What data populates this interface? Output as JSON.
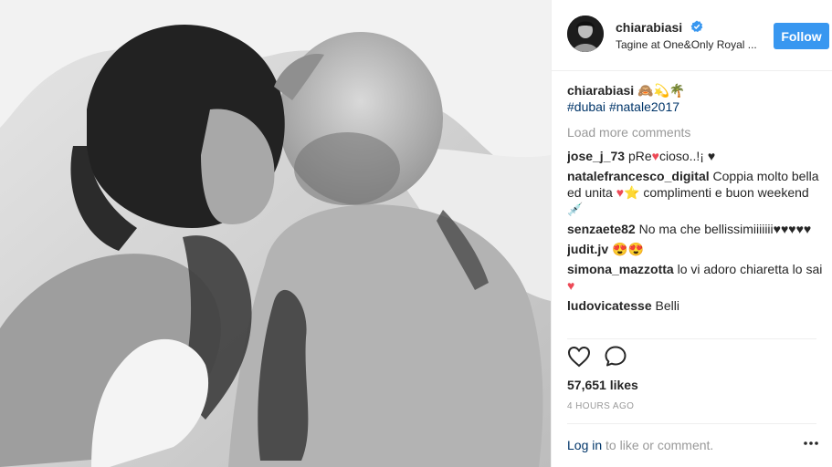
{
  "post": {
    "username": "chiarabiasi",
    "location": "Tagine at One&Only Royal ...",
    "follow_label": "Follow"
  },
  "caption": {
    "username": "chiarabiasi",
    "text": "🙈💫🌴",
    "hashtag_1": "#dubai",
    "hashtag_2": "#natale2017"
  },
  "load_more_label": "Load more comments",
  "comments": [
    {
      "user": "jose_j_73",
      "text_a": "pRe",
      "heart": "♥",
      "text_b": "cioso..!¡ ♥"
    },
    {
      "user": "natalefrancesco_digital",
      "text_a": "Coppia molto bella ed unita ",
      "heart": "♥",
      "text_b": "⭐ complimenti e buon weekend 💉"
    },
    {
      "user": "senzaete82",
      "text_a": "No ma che bellissimiiiiiii♥♥♥♥♥"
    },
    {
      "user": "judit.jv",
      "text_a": "😍😍"
    },
    {
      "user": "simona_mazzotta",
      "text_a": "lo vi adoro chiaretta lo sai ",
      "heart": "♥"
    },
    {
      "user": "ludovicatesse",
      "text_a": "Belli"
    }
  ],
  "likes": "57,651 likes",
  "time": "4 HOURS AGO",
  "login": {
    "link": "Log in",
    "rest": " to like or comment."
  },
  "icons": {
    "like": "heart-outline-icon",
    "comment": "comment-bubble-icon",
    "more": "more-dots-icon",
    "verified": "verified-badge-icon"
  },
  "colors": {
    "follow_button": "#3897f0",
    "link": "#003569",
    "muted": "#999999",
    "heart": "#ed4956"
  }
}
